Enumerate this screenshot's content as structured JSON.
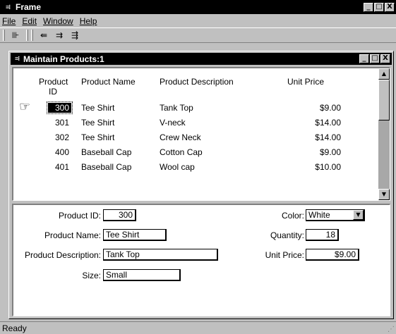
{
  "window": {
    "title": "Frame",
    "controls": {
      "minimize": "_",
      "maximize": "□",
      "close": "X"
    }
  },
  "menu": [
    "File",
    "Edit",
    "Window",
    "Help"
  ],
  "toolbar": {
    "icons": [
      "exit-icon",
      "retrieve-icon",
      "insert-row-icon",
      "delete-row-icon"
    ]
  },
  "child_window": {
    "title": "Maintain Products:1"
  },
  "list": {
    "columns": [
      "Product ID",
      "Product Name",
      "Product Description",
      "Unit Price"
    ],
    "column_id_line1": "Product",
    "column_id_line2": "ID",
    "rows": [
      {
        "id": "300",
        "name": "Tee Shirt",
        "description": "Tank Top",
        "price": "$9.00",
        "selected": true
      },
      {
        "id": "301",
        "name": "Tee Shirt",
        "description": "V-neck",
        "price": "$14.00"
      },
      {
        "id": "302",
        "name": "Tee Shirt",
        "description": "Crew Neck",
        "price": "$14.00"
      },
      {
        "id": "400",
        "name": "Baseball Cap",
        "description": "Cotton Cap",
        "price": "$9.00"
      },
      {
        "id": "401",
        "name": "Baseball Cap",
        "description": "Wool cap",
        "price": "$10.00"
      }
    ]
  },
  "detail": {
    "product_id_label": "Product ID:",
    "product_id": "300",
    "product_name_label": "Product Name:",
    "product_name": "Tee Shirt",
    "product_description_label": "Product Description:",
    "product_description": "Tank Top",
    "size_label": "Size:",
    "size": "Small",
    "color_label": "Color:",
    "color": "White",
    "quantity_label": "Quantity:",
    "quantity": "18",
    "unit_price_label": "Unit Price:",
    "unit_price": "$9.00"
  },
  "status": "Ready"
}
